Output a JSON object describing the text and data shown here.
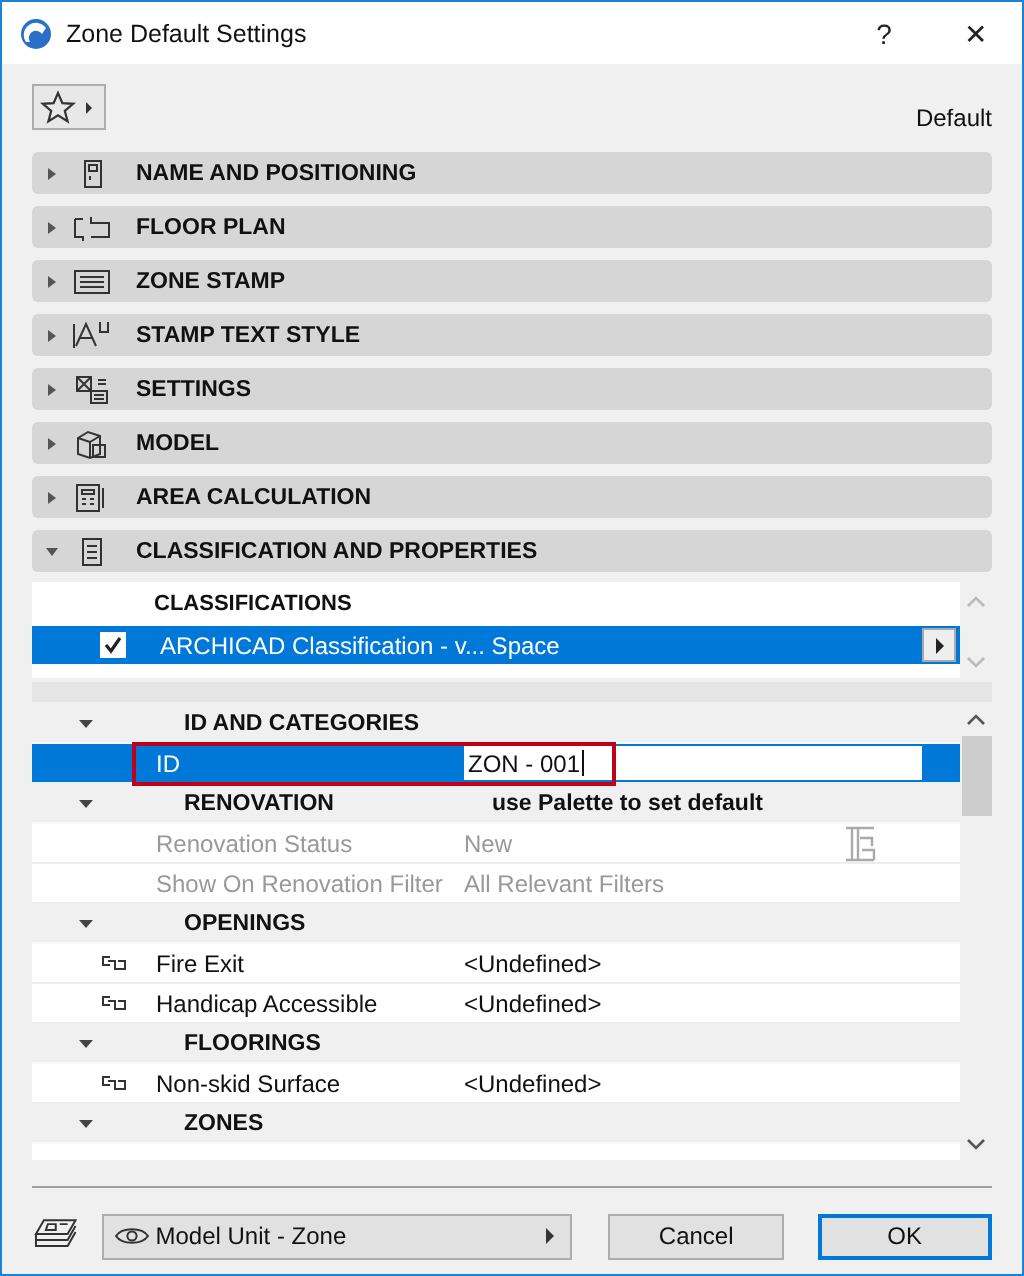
{
  "window": {
    "title": "Zone Default Settings",
    "help": "?",
    "close": "✕"
  },
  "preset_label": "Default",
  "sections": [
    {
      "label": "NAME AND POSITIONING",
      "expanded": false
    },
    {
      "label": "FLOOR PLAN",
      "expanded": false
    },
    {
      "label": "ZONE STAMP",
      "expanded": false
    },
    {
      "label": "STAMP TEXT STYLE",
      "expanded": false
    },
    {
      "label": "SETTINGS",
      "expanded": false
    },
    {
      "label": "MODEL",
      "expanded": false
    },
    {
      "label": "AREA CALCULATION",
      "expanded": false
    },
    {
      "label": "CLASSIFICATION AND PROPERTIES",
      "expanded": true
    }
  ],
  "classifications": {
    "header": "CLASSIFICATIONS",
    "rows": [
      {
        "label": "ARCHICAD Classification - v... Space",
        "checked": true,
        "selected": true
      }
    ]
  },
  "property_groups": [
    {
      "name": "ID AND CATEGORIES",
      "expanded": true,
      "rows": [
        {
          "name": "ID",
          "value": "ZON - 001",
          "selected": true,
          "highlighted": true,
          "disabled": false,
          "linked": false
        }
      ]
    },
    {
      "name": "RENOVATION",
      "note": "use Palette to set default",
      "expanded": true,
      "rows": [
        {
          "name": "Renovation Status",
          "value": "New",
          "selected": false,
          "highlighted": false,
          "disabled": true,
          "linked": false
        },
        {
          "name": "Show On Renovation Filter",
          "value": "All Relevant Filters",
          "selected": false,
          "highlighted": false,
          "disabled": true,
          "linked": false
        }
      ]
    },
    {
      "name": "OPENINGS",
      "expanded": true,
      "rows": [
        {
          "name": "Fire Exit",
          "value": "<Undefined>",
          "selected": false,
          "highlighted": false,
          "disabled": false,
          "linked": true
        },
        {
          "name": "Handicap Accessible",
          "value": "<Undefined>",
          "selected": false,
          "highlighted": false,
          "disabled": false,
          "linked": true
        }
      ]
    },
    {
      "name": "FLOORINGS",
      "expanded": true,
      "rows": [
        {
          "name": "Non-skid Surface",
          "value": "<Undefined>",
          "selected": false,
          "highlighted": false,
          "disabled": false,
          "linked": true
        }
      ]
    },
    {
      "name": "ZONES",
      "expanded": true
    }
  ],
  "footer": {
    "layer": "Model Unit - Zone",
    "buttons": [
      {
        "label": "Cancel",
        "default": false
      },
      {
        "label": "OK",
        "default": true
      }
    ]
  }
}
